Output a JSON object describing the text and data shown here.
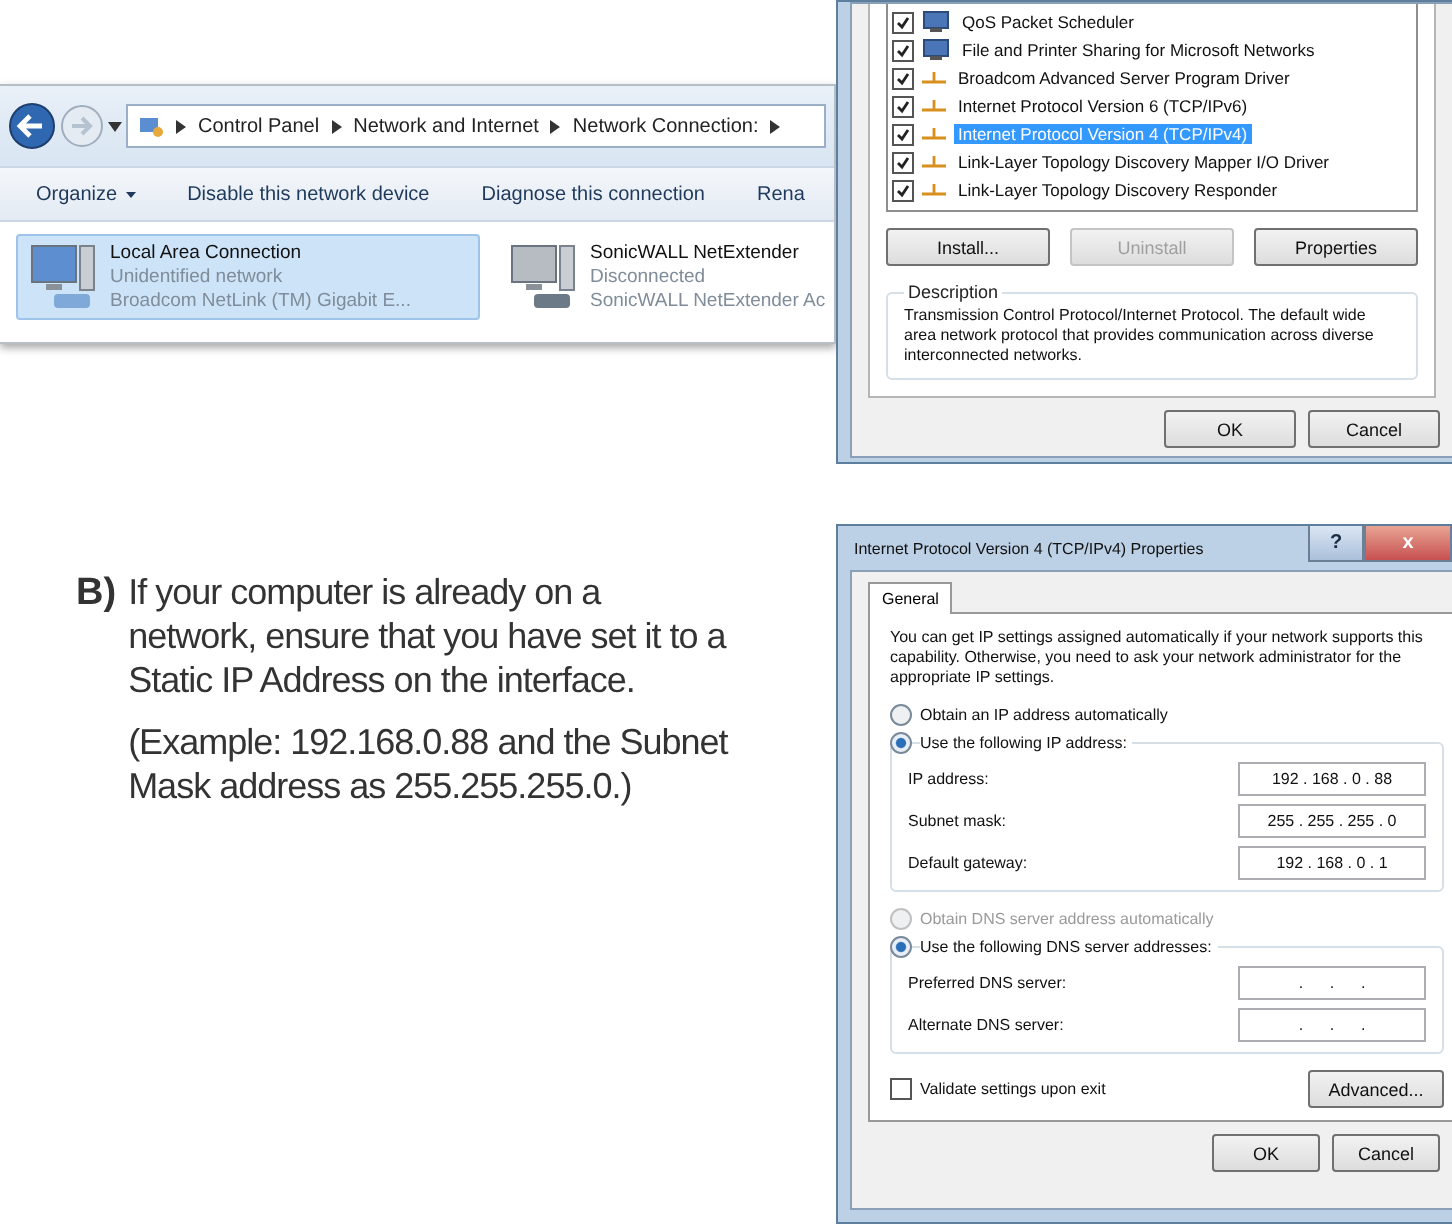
{
  "explorer": {
    "breadcrumb": [
      "Control Panel",
      "Network and Internet",
      "Network Connection:"
    ],
    "toolbar": [
      {
        "label": "Organize",
        "menu": true
      },
      {
        "label": "Disable this network device",
        "menu": false
      },
      {
        "label": "Diagnose this connection",
        "menu": false
      },
      {
        "label": "Rena",
        "menu": false
      }
    ],
    "connections": [
      {
        "name": "Local Area Connection",
        "status": "Unidentified network",
        "device": "Broadcom NetLink (TM) Gigabit E...",
        "selected": true
      },
      {
        "name": "SonicWALL NetExtender",
        "status": "Disconnected",
        "device": "SonicWALL NetExtender Ac",
        "selected": false
      }
    ]
  },
  "instruction": {
    "marker": "B)",
    "paragraphs": [
      "If your computer is already on a network, ensure that you have set it to a Static IP Address on the interface.",
      "(Example: 192.168.0.88 and the Subnet Mask address as 255.255.255.0.)"
    ]
  },
  "adapter_properties": {
    "items": [
      {
        "label": "QoS Packet Scheduler",
        "kind": "service",
        "checked": true,
        "selected": false
      },
      {
        "label": "File and Printer Sharing for Microsoft Networks",
        "kind": "service",
        "checked": true,
        "selected": false
      },
      {
        "label": "Broadcom Advanced Server Program Driver",
        "kind": "protocol",
        "checked": true,
        "selected": false
      },
      {
        "label": "Internet Protocol Version 6 (TCP/IPv6)",
        "kind": "protocol",
        "checked": true,
        "selected": false
      },
      {
        "label": "Internet Protocol Version 4 (TCP/IPv4)",
        "kind": "protocol",
        "checked": true,
        "selected": true
      },
      {
        "label": "Link-Layer Topology Discovery Mapper I/O Driver",
        "kind": "protocol",
        "checked": true,
        "selected": false
      },
      {
        "label": "Link-Layer Topology Discovery Responder",
        "kind": "protocol",
        "checked": true,
        "selected": false
      }
    ],
    "buttons": [
      {
        "label": "Install...",
        "disabled": false
      },
      {
        "label": "Uninstall",
        "disabled": true
      },
      {
        "label": "Properties",
        "disabled": false
      }
    ],
    "description": {
      "title": "Description",
      "text": "Transmission Control Protocol/Internet Protocol. The default wide area network protocol that provides communication across diverse interconnected networks."
    },
    "footer": [
      "OK",
      "Cancel"
    ]
  },
  "ipv4_dialog": {
    "title": "Internet Protocol Version 4 (TCP/IPv4) Properties",
    "help": "?",
    "close": "x",
    "tabs": [
      {
        "label": "General",
        "selected": true
      }
    ],
    "intro": "You can get IP settings assigned automatically if your network supports this capability. Otherwise, you need to ask your network administrator for the appropriate IP settings.",
    "groups": [
      {
        "auto": {
          "label": "Obtain an IP address automatically",
          "selected": false,
          "disabled": false
        },
        "manual": {
          "label": "Use the following IP address:",
          "selected": true,
          "disabled": false
        },
        "fields": [
          {
            "label": "IP address:",
            "value": "192 . 168 . 0 . 88"
          },
          {
            "label": "Subnet mask:",
            "value": "255 . 255 . 255 . 0"
          },
          {
            "label": "Default gateway:",
            "value": "192 . 168 . 0 . 1"
          }
        ]
      },
      {
        "auto": {
          "label": "Obtain DNS server address automatically",
          "selected": false,
          "disabled": true
        },
        "manual": {
          "label": "Use the following DNS server addresses:",
          "selected": true,
          "disabled": false
        },
        "fields": [
          {
            "label": "Preferred DNS server:",
            "value": ".      .      ."
          },
          {
            "label": "Alternate DNS server:",
            "value": ".      .      ."
          }
        ]
      }
    ],
    "validate": {
      "label": "Validate settings upon exit",
      "checked": false
    },
    "advanced": "Advanced...",
    "footer": [
      "OK",
      "Cancel"
    ]
  }
}
